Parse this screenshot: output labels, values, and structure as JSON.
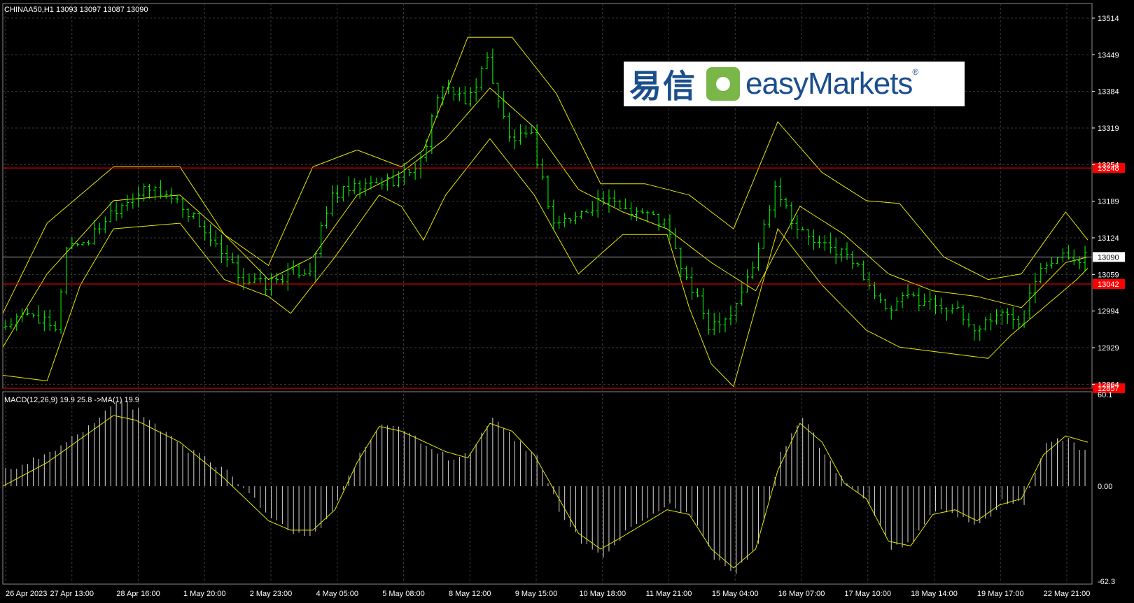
{
  "header": {
    "symbol_line": "CHINAA50,H1  13093 13097 13087 13090",
    "macd_line": "MACD(12,26,9) 19.9 25.8 ->MA(1) 19.9"
  },
  "logo": {
    "chinese": "易信",
    "brand": "easyMarkets",
    "registered": "®",
    "colors": {
      "brand_blue": "#1b4e8c",
      "brand_green": "#7ab648"
    }
  },
  "colors": {
    "background": "#000000",
    "grid": "#3a3a3a",
    "candles": "#00ff00",
    "bollinger": "#e6e600",
    "level_line": "#ff0000",
    "macd_hist": "#d8d8d8",
    "signal": "#e6e600"
  },
  "chart_data": [
    {
      "type": "candlestick",
      "name": "price",
      "ylim": [
        12857,
        13540
      ],
      "y_ticks": [
        13514,
        13449,
        13384,
        13319,
        13254,
        13189,
        13124,
        13059,
        12994,
        12929,
        12864
      ],
      "current_price": {
        "label": "13090",
        "value": 13090
      },
      "levels": [
        {
          "label": "13248",
          "value": 13248
        },
        {
          "label": "13042",
          "value": 13042
        },
        {
          "label": "12857",
          "value": 12857
        }
      ],
      "x_labels": [
        "26 Apr 2023",
        "27 Apr 13:00",
        "28 Apr 16:00",
        "1 May 20:00",
        "2 May 23:00",
        "4 May 05:00",
        "5 May 08:00",
        "8 May 12:00",
        "9 May 15:00",
        "10 May 18:00",
        "11 May 21:00",
        "15 May 04:00",
        "16 May 07:00",
        "17 May 10:00",
        "18 May 14:00",
        "19 May 17:00",
        "22 May 21:00"
      ],
      "close_path": [
        [
          0,
          12965
        ],
        [
          6,
          12990
        ],
        [
          10,
          12955
        ],
        [
          12,
          13110
        ],
        [
          16,
          13120
        ],
        [
          20,
          13170
        ],
        [
          24,
          13200
        ],
        [
          28,
          13210
        ],
        [
          32,
          13190
        ],
        [
          36,
          13150
        ],
        [
          40,
          13090
        ],
        [
          44,
          13050
        ],
        [
          48,
          13040
        ],
        [
          52,
          13060
        ],
        [
          56,
          13070
        ],
        [
          60,
          13200
        ],
        [
          64,
          13210
        ],
        [
          68,
          13220
        ],
        [
          72,
          13230
        ],
        [
          76,
          13260
        ],
        [
          80,
          13400
        ],
        [
          84,
          13360
        ],
        [
          88,
          13440
        ],
        [
          92,
          13300
        ],
        [
          96,
          13300
        ],
        [
          100,
          13150
        ],
        [
          104,
          13160
        ],
        [
          108,
          13190
        ],
        [
          112,
          13180
        ],
        [
          116,
          13170
        ],
        [
          120,
          13150
        ],
        [
          124,
          13050
        ],
        [
          128,
          12970
        ],
        [
          132,
          12990
        ],
        [
          136,
          13070
        ],
        [
          140,
          13220
        ],
        [
          144,
          13140
        ],
        [
          148,
          13110
        ],
        [
          152,
          13100
        ],
        [
          156,
          13060
        ],
        [
          160,
          12990
        ],
        [
          164,
          13020
        ],
        [
          168,
          13010
        ],
        [
          172,
          13000
        ],
        [
          176,
          12960
        ],
        [
          180,
          12990
        ],
        [
          184,
          12980
        ],
        [
          188,
          13080
        ],
        [
          192,
          13090
        ]
      ],
      "bollinger": {
        "upper": [
          [
            0,
            12990
          ],
          [
            8,
            13150
          ],
          [
            20,
            13250
          ],
          [
            32,
            13250
          ],
          [
            40,
            13130
          ],
          [
            48,
            13075
          ],
          [
            56,
            13250
          ],
          [
            64,
            13280
          ],
          [
            72,
            13250
          ],
          [
            76,
            13280
          ],
          [
            84,
            13480
          ],
          [
            92,
            13480
          ],
          [
            100,
            13380
          ],
          [
            108,
            13220
          ],
          [
            116,
            13220
          ],
          [
            124,
            13200
          ],
          [
            132,
            13140
          ],
          [
            140,
            13330
          ],
          [
            148,
            13240
          ],
          [
            156,
            13190
          ],
          [
            162,
            13185
          ],
          [
            170,
            13090
          ],
          [
            178,
            13050
          ],
          [
            184,
            13060
          ],
          [
            192,
            13170
          ],
          [
            196,
            13120
          ]
        ],
        "middle": [
          [
            0,
            12930
          ],
          [
            8,
            13060
          ],
          [
            20,
            13190
          ],
          [
            32,
            13200
          ],
          [
            40,
            13130
          ],
          [
            48,
            13050
          ],
          [
            56,
            13090
          ],
          [
            64,
            13200
          ],
          [
            72,
            13240
          ],
          [
            80,
            13300
          ],
          [
            88,
            13390
          ],
          [
            96,
            13320
          ],
          [
            104,
            13210
          ],
          [
            112,
            13170
          ],
          [
            120,
            13140
          ],
          [
            128,
            13080
          ],
          [
            136,
            13030
          ],
          [
            144,
            13180
          ],
          [
            152,
            13130
          ],
          [
            160,
            13060
          ],
          [
            168,
            13030
          ],
          [
            176,
            13020
          ],
          [
            184,
            13000
          ],
          [
            192,
            13080
          ],
          [
            196,
            13090
          ]
        ],
        "lower": [
          [
            0,
            12880
          ],
          [
            8,
            12870
          ],
          [
            14,
            13040
          ],
          [
            20,
            13140
          ],
          [
            32,
            13150
          ],
          [
            40,
            13050
          ],
          [
            48,
            13020
          ],
          [
            52,
            12990
          ],
          [
            60,
            13090
          ],
          [
            68,
            13200
          ],
          [
            72,
            13180
          ],
          [
            76,
            13120
          ],
          [
            80,
            13200
          ],
          [
            88,
            13300
          ],
          [
            96,
            13200
          ],
          [
            104,
            13060
          ],
          [
            112,
            13130
          ],
          [
            120,
            13130
          ],
          [
            124,
            13000
          ],
          [
            128,
            12900
          ],
          [
            132,
            12860
          ],
          [
            136,
            13000
          ],
          [
            140,
            13140
          ],
          [
            148,
            13040
          ],
          [
            156,
            12960
          ],
          [
            162,
            12930
          ],
          [
            170,
            12920
          ],
          [
            178,
            12910
          ],
          [
            182,
            12950
          ],
          [
            188,
            13000
          ],
          [
            194,
            13050
          ],
          [
            196,
            13070
          ]
        ]
      }
    },
    {
      "type": "bar",
      "name": "MACD(12,26,9)",
      "ylim": [
        -62.3,
        60.1
      ],
      "y_ticks": [
        60.1,
        0.0,
        -62.3
      ],
      "histogram_path": [
        [
          0,
          10
        ],
        [
          8,
          20
        ],
        [
          16,
          40
        ],
        [
          20,
          55
        ],
        [
          24,
          48
        ],
        [
          32,
          25
        ],
        [
          40,
          10
        ],
        [
          48,
          -20
        ],
        [
          52,
          -30
        ],
        [
          56,
          -30
        ],
        [
          60,
          -10
        ],
        [
          64,
          20
        ],
        [
          68,
          40
        ],
        [
          72,
          35
        ],
        [
          80,
          18
        ],
        [
          84,
          20
        ],
        [
          88,
          45
        ],
        [
          92,
          30
        ],
        [
          96,
          18
        ],
        [
          100,
          -15
        ],
        [
          104,
          -35
        ],
        [
          108,
          -45
        ],
        [
          112,
          -30
        ],
        [
          120,
          -12
        ],
        [
          124,
          -20
        ],
        [
          128,
          -45
        ],
        [
          132,
          -55
        ],
        [
          136,
          -35
        ],
        [
          140,
          20
        ],
        [
          144,
          45
        ],
        [
          148,
          20
        ],
        [
          152,
          0
        ],
        [
          156,
          -10
        ],
        [
          160,
          -40
        ],
        [
          164,
          -35
        ],
        [
          168,
          -15
        ],
        [
          172,
          -20
        ],
        [
          176,
          -25
        ],
        [
          180,
          -10
        ],
        [
          184,
          -10
        ],
        [
          188,
          28
        ],
        [
          192,
          30
        ],
        [
          196,
          20
        ]
      ],
      "signal_path": [
        [
          0,
          0
        ],
        [
          8,
          15
        ],
        [
          16,
          35
        ],
        [
          20,
          45
        ],
        [
          24,
          42
        ],
        [
          32,
          28
        ],
        [
          40,
          5
        ],
        [
          48,
          -22
        ],
        [
          52,
          -28
        ],
        [
          56,
          -28
        ],
        [
          60,
          -15
        ],
        [
          64,
          15
        ],
        [
          68,
          38
        ],
        [
          72,
          35
        ],
        [
          80,
          22
        ],
        [
          84,
          18
        ],
        [
          88,
          40
        ],
        [
          92,
          35
        ],
        [
          96,
          20
        ],
        [
          100,
          -5
        ],
        [
          104,
          -30
        ],
        [
          108,
          -40
        ],
        [
          112,
          -32
        ],
        [
          120,
          -15
        ],
        [
          124,
          -18
        ],
        [
          128,
          -40
        ],
        [
          132,
          -52
        ],
        [
          136,
          -40
        ],
        [
          140,
          10
        ],
        [
          144,
          40
        ],
        [
          148,
          28
        ],
        [
          152,
          2
        ],
        [
          156,
          -8
        ],
        [
          160,
          -35
        ],
        [
          164,
          -38
        ],
        [
          168,
          -18
        ],
        [
          172,
          -15
        ],
        [
          176,
          -22
        ],
        [
          180,
          -12
        ],
        [
          184,
          -8
        ],
        [
          188,
          20
        ],
        [
          192,
          32
        ],
        [
          196,
          28
        ]
      ]
    }
  ]
}
